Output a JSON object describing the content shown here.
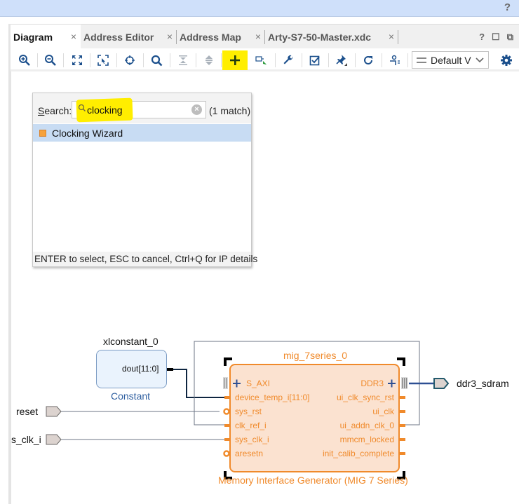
{
  "topbar": {
    "help_label": "?"
  },
  "tabs": [
    {
      "label": "Diagram",
      "active": true,
      "close": "×"
    },
    {
      "label": "Address Editor",
      "active": false,
      "close": "×"
    },
    {
      "label": "Address Map",
      "active": false,
      "close": "×"
    },
    {
      "label": "Arty-S7-50-Master.xdc",
      "active": false,
      "close": "×"
    }
  ],
  "tab_actions": {
    "help": "?",
    "maximize": "☐",
    "float": "⧉"
  },
  "toolbar": {
    "icons": [
      "zoom-in-icon",
      "zoom-out-icon",
      "zoom-fit-icon",
      "zoom-selection-icon",
      "center-icon",
      "search-icon",
      "collapse-icon",
      "expand-icon",
      "add-ip-icon",
      "add-module-icon",
      "wrench-icon",
      "validate-icon",
      "pin-icon",
      "refresh-icon",
      "regenerate-layout-icon"
    ],
    "highlighted": "add-ip-icon",
    "view_select": {
      "value": "Default V"
    },
    "settings_icon": "gear-icon"
  },
  "search_popup": {
    "label_prefix": "S",
    "label_rest": "earch:",
    "query": "clocking",
    "match_count": "(1 match)",
    "results": [
      {
        "label": "Clocking Wizard",
        "selected": true
      }
    ],
    "footer": "ENTER to select, ESC to cancel, Ctrl+Q for IP details"
  },
  "diagram": {
    "ports_in": [
      {
        "name": "reset"
      },
      {
        "name": "s_clk_i"
      }
    ],
    "port_out": {
      "name": "ddr3_sdram"
    },
    "constant": {
      "instance": "xlconstant_0",
      "type": "Constant",
      "pin": "dout[11:0]"
    },
    "mig": {
      "instance": "mig_7series_0",
      "type": "Memory Interface Generator (MIG 7 Series)",
      "left_pins": [
        "S_AXI",
        "device_temp_i[11:0]",
        "sys_rst",
        "clk_ref_i",
        "sys_clk_i",
        "aresetn"
      ],
      "right_pins": [
        "DDR3",
        "ui_clk_sync_rst",
        "ui_clk",
        "ui_addn_clk_0",
        "mmcm_locked",
        "init_calib_complete"
      ]
    }
  },
  "colors": {
    "highlight": "#ffee00",
    "ip_orange": "#f08a2b",
    "ip_fill": "#fbe2d0",
    "accent_blue": "#1b4f8c"
  }
}
